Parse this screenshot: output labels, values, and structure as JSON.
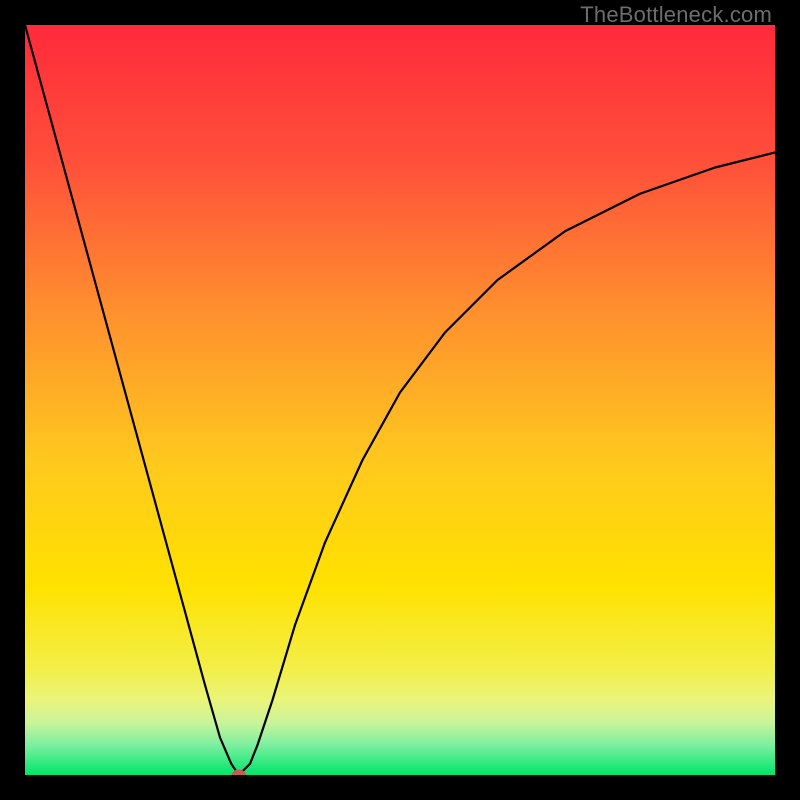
{
  "watermark": "TheBottleneck.com",
  "chart_data": {
    "type": "line",
    "title": "",
    "xlabel": "",
    "ylabel": "",
    "xlim": [
      0,
      100
    ],
    "ylim": [
      0,
      100
    ],
    "grid": false,
    "legend": false,
    "background_gradient": {
      "top_color": "#ff2a3b",
      "mid_color": "#ffe200",
      "bottom_color": "#00e56a",
      "green_band_start_pct": 90,
      "green_band_end_pct": 100
    },
    "series": [
      {
        "name": "bottleneck-curve",
        "x": [
          0,
          3,
          6,
          9,
          12,
          15,
          18,
          21,
          24,
          26,
          27.5,
          28.5,
          30,
          31,
          33,
          36,
          40,
          45,
          50,
          56,
          63,
          72,
          82,
          92,
          100
        ],
        "values": [
          100,
          89,
          78,
          67,
          56,
          45,
          34,
          23,
          12,
          5,
          1.5,
          0,
          1.5,
          4,
          10,
          20,
          31,
          42,
          51,
          59,
          66,
          72.5,
          77.5,
          81,
          83
        ]
      }
    ],
    "marker": {
      "name": "minimum-point",
      "x": 28.5,
      "y": 0,
      "color": "#c85a54",
      "rx": 7,
      "ry": 5.5
    }
  }
}
